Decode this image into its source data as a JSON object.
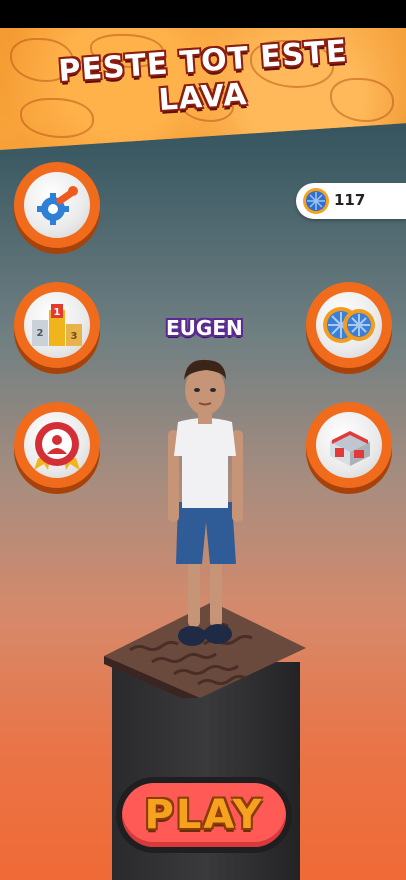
{
  "header": {
    "title_line1": "PESTE TOT ESTE",
    "title_line2": "LAVA"
  },
  "currency": {
    "icon": "orange-slice-icon",
    "count": "117"
  },
  "left_menu": [
    {
      "name": "settings-button",
      "icon": "wrench-gear-icon"
    },
    {
      "name": "leaderboard-button",
      "icon": "podium-icon",
      "podium_labels": [
        "2",
        "1",
        "3"
      ]
    },
    {
      "name": "profile-button",
      "icon": "user-badge-icon"
    }
  ],
  "right_menu": [
    {
      "name": "oranges-button",
      "icon": "orange-slices-icon"
    },
    {
      "name": "shop-button",
      "icon": "store-icon"
    }
  ],
  "player": {
    "name": "EUGEN"
  },
  "play_button": {
    "label": "PLAY"
  },
  "colors": {
    "accent_orange": "#f06b1c",
    "play_red": "#ff5a55",
    "play_text": "#f7a21e"
  }
}
